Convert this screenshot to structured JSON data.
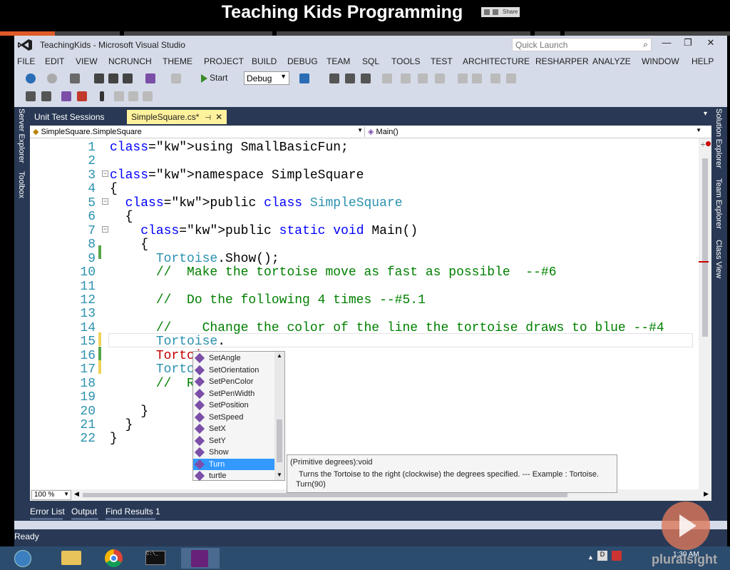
{
  "video": {
    "title": "Teaching Kids Programming",
    "share_label": "Share",
    "progress_fraction": 0.075
  },
  "window": {
    "title": "TeachingKids - Microsoft Visual Studio",
    "quick_launch_placeholder": "Quick Launch",
    "minimize": "—",
    "maximize": "❐",
    "close": "✕"
  },
  "menu": {
    "items": [
      "FILE",
      "EDIT",
      "VIEW",
      "NCRUNCH",
      "THEME",
      "PROJECT",
      "BUILD",
      "DEBUG",
      "TEAM",
      "SQL",
      "TOOLS",
      "TEST",
      "ARCHITECTURE",
      "RESHARPER",
      "ANALYZE",
      "WINDOW",
      "HELP"
    ]
  },
  "toolbar": {
    "start_label": "Start",
    "config_value": "Debug"
  },
  "side_panels": {
    "left": [
      "Server Explorer",
      "Toolbox"
    ],
    "right": [
      "Solution Explorer",
      "Team Explorer",
      "Class View"
    ]
  },
  "tabs": [
    {
      "label": "Unit Test Sessions",
      "active": false
    },
    {
      "label": "SimpleSquare.cs*",
      "active": true
    }
  ],
  "navbar": {
    "left": "SimpleSquare.SimpleSquare",
    "right": "Main()"
  },
  "code": {
    "lines": [
      "using SmallBasicFun;",
      "",
      "namespace SimpleSquare",
      "{",
      "  public class SimpleSquare",
      "  {",
      "    public static void Main()",
      "    {",
      "      Tortoise.Show();",
      "      //  Make the tortoise move as fast as possible  --#6",
      "",
      "      //  Do the following 4 times --#5.1",
      "",
      "      //    Change the color of the line the tortoise draws to blue --#4",
      "      Tortoise.",
      "      Tortois",
      "      Tortois",
      "      //  Rep",
      "",
      "    }",
      "  }",
      "}"
    ]
  },
  "completion": {
    "items": [
      "SetAngle",
      "SetOrientation",
      "SetPenColor",
      "SetPenWidth",
      "SetPosition",
      "SetSpeed",
      "SetX",
      "SetY",
      "Show",
      "Turn",
      "turtle"
    ],
    "selected": "Turn"
  },
  "tooltip": {
    "signature": "(Primitive degrees):void",
    "description": "Turns the Tortoise to the right (clockwise) the degrees specified. --- Example : Tortoise.",
    "example": "Turn(90)"
  },
  "editor": {
    "zoom": "100 %"
  },
  "bottom_tabs": [
    "Error List",
    "Output",
    "Find Results 1"
  ],
  "status": "Ready",
  "tray": {
    "time": "1:30 AM"
  },
  "brand": "pluralsight"
}
